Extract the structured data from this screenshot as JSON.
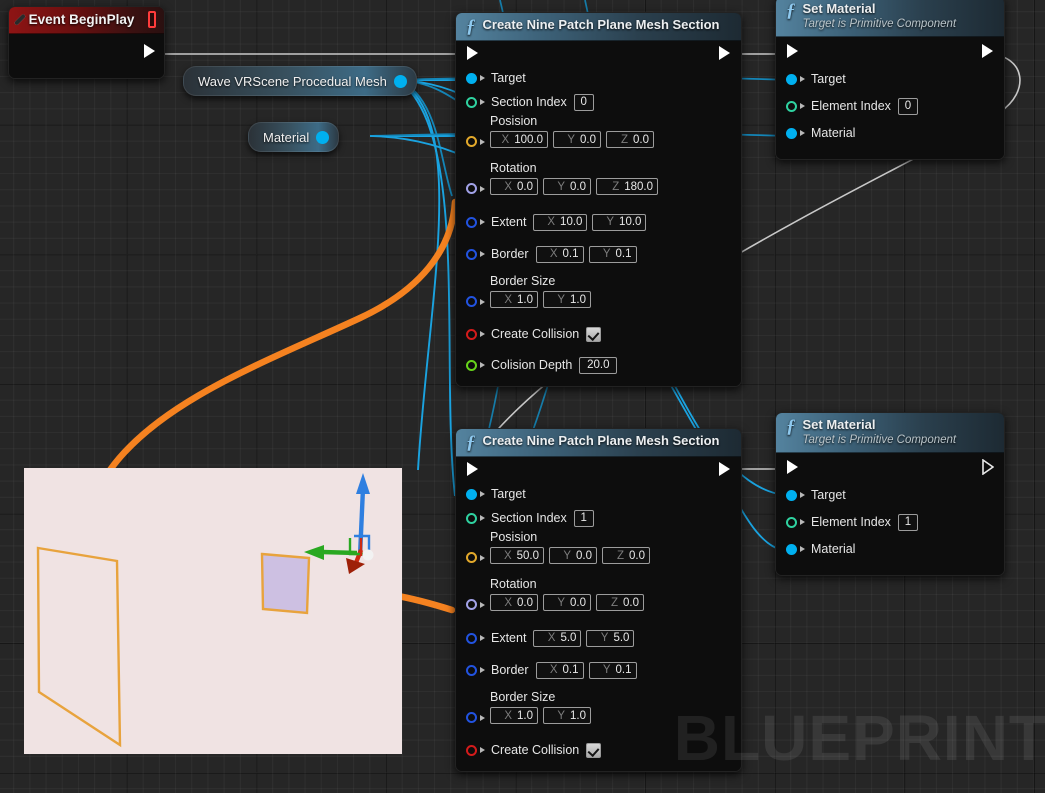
{
  "app": {
    "watermark": "BLUEPRINT",
    "accent_blue": "#00b0f0",
    "accent_orange": "#f58220",
    "exec_wire_color": "#c8c8c8",
    "grid_bg": "#262626"
  },
  "nodes": {
    "event_begin_play": {
      "title": "Event BeginPlay",
      "icon": "diamond-icon",
      "delegate_pin": "red-square-pin",
      "exec_out": "exec-out"
    },
    "reroute_mesh": {
      "label": "Wave VRScene Procedual Mesh"
    },
    "reroute_material": {
      "label": "Material"
    },
    "nine_patch_1": {
      "title": "Create Nine Patch Plane Mesh Section",
      "icon": "function-f-icon",
      "pins": {
        "target": "Target",
        "section_index": {
          "label": "Section Index",
          "value": "0"
        },
        "position": {
          "label": "Posision",
          "x_axis": "X",
          "x": "100.0",
          "y_axis": "Y",
          "y": "0.0",
          "z_axis": "Z",
          "z": "0.0"
        },
        "rotation": {
          "label": "Rotation",
          "x_axis": "X",
          "x": "0.0",
          "y_axis": "Y",
          "y": "0.0",
          "z_axis": "Z",
          "z": "180.0"
        },
        "extent": {
          "label": "Extent",
          "x_axis": "X",
          "x": "10.0",
          "y_axis": "Y",
          "y": "10.0"
        },
        "border": {
          "label": "Border",
          "x_axis": "X",
          "x": "0.1",
          "y_axis": "Y",
          "y": "0.1"
        },
        "border_size": {
          "label": "Border Size",
          "x_axis": "X",
          "x": "1.0",
          "y_axis": "Y",
          "y": "1.0"
        },
        "create_collision": {
          "label": "Create Collision",
          "checked": true
        },
        "collision_depth": {
          "label": "Colision Depth",
          "value": "20.0"
        }
      }
    },
    "nine_patch_2": {
      "title": "Create Nine Patch Plane Mesh Section",
      "icon": "function-f-icon",
      "pins": {
        "target": "Target",
        "section_index": {
          "label": "Section Index",
          "value": "1"
        },
        "position": {
          "label": "Posision",
          "x_axis": "X",
          "x": "50.0",
          "y_axis": "Y",
          "y": "0.0",
          "z_axis": "Z",
          "z": "0.0"
        },
        "rotation": {
          "label": "Rotation",
          "x_axis": "X",
          "x": "0.0",
          "y_axis": "Y",
          "y": "0.0",
          "z_axis": "Z",
          "z": "0.0"
        },
        "extent": {
          "label": "Extent",
          "x_axis": "X",
          "x": "5.0",
          "y_axis": "Y",
          "y": "5.0"
        },
        "border": {
          "label": "Border",
          "x_axis": "X",
          "x": "0.1",
          "y_axis": "Y",
          "y": "0.1"
        },
        "border_size": {
          "label": "Border Size",
          "x_axis": "X",
          "x": "1.0",
          "y_axis": "Y",
          "y": "1.0"
        },
        "create_collision": {
          "label": "Create Collision",
          "checked": true
        }
      }
    },
    "set_material_1": {
      "title": "Set Material",
      "subtitle": "Target is Primitive Component",
      "icon": "function-f-icon",
      "pins": {
        "target": "Target",
        "element_index": {
          "label": "Element Index",
          "value": "0"
        },
        "material": "Material"
      }
    },
    "set_material_2": {
      "title": "Set Material",
      "subtitle": "Target is Primitive Component",
      "icon": "function-f-icon",
      "pins": {
        "target": "Target",
        "element_index": {
          "label": "Element Index",
          "value": "1"
        },
        "material": "Material"
      }
    }
  },
  "viewport": {
    "name": "3d-preview-viewport",
    "background_color": "#f0e3e3",
    "large_quad_color": "#e8a33d",
    "small_quad_fill": "#cdc0e2",
    "gizmo": {
      "x_axis": "#cc2a12",
      "y_axis": "#2aa821",
      "z_axis": "#2f7fe0"
    }
  },
  "annotations": {
    "arrow_1": "orange-annotation-stroke-1",
    "arrow_2": "orange-annotation-stroke-2"
  }
}
